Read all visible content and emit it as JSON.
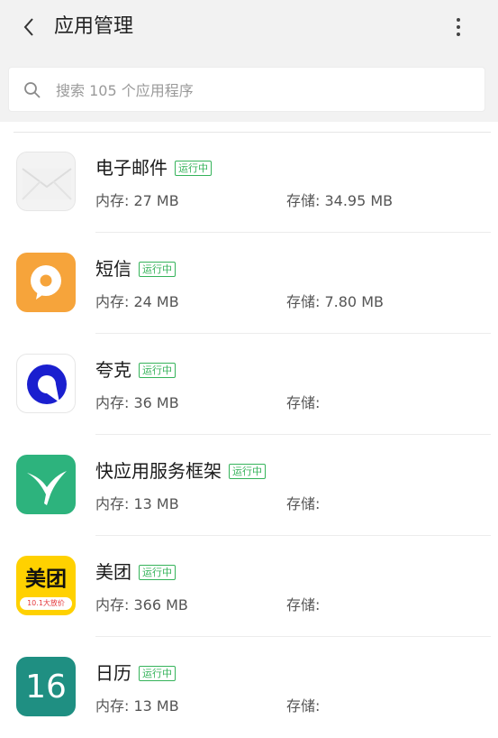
{
  "header": {
    "title": "应用管理",
    "back_icon": "back-chevron-icon",
    "more_icon": "more-vertical-icon"
  },
  "search": {
    "placeholder": "搜索 105 个应用程序",
    "value": ""
  },
  "running_label": "运行中",
  "apps": [
    {
      "name": "电子邮件",
      "memory": "内存: 27 MB",
      "storage": "存储: 34.95 MB",
      "icon": "email-icon"
    },
    {
      "name": "短信",
      "memory": "内存: 24 MB",
      "storage": "存储: 7.80 MB",
      "icon": "messages-icon"
    },
    {
      "name": "夸克",
      "memory": "内存: 36 MB",
      "storage": "存储:",
      "icon": "quark-icon"
    },
    {
      "name": "快应用服务框架",
      "memory": "内存: 13 MB",
      "storage": "存储:",
      "icon": "quickapp-icon"
    },
    {
      "name": "美团",
      "memory": "内存: 366 MB",
      "storage": "存储:",
      "icon": "meituan-icon",
      "icon_text": "美团",
      "icon_subtext": "10.1大放价"
    },
    {
      "name": "日历",
      "memory": "内存: 13 MB",
      "storage": "存储:",
      "icon": "calendar-icon",
      "icon_text": "16"
    }
  ]
}
